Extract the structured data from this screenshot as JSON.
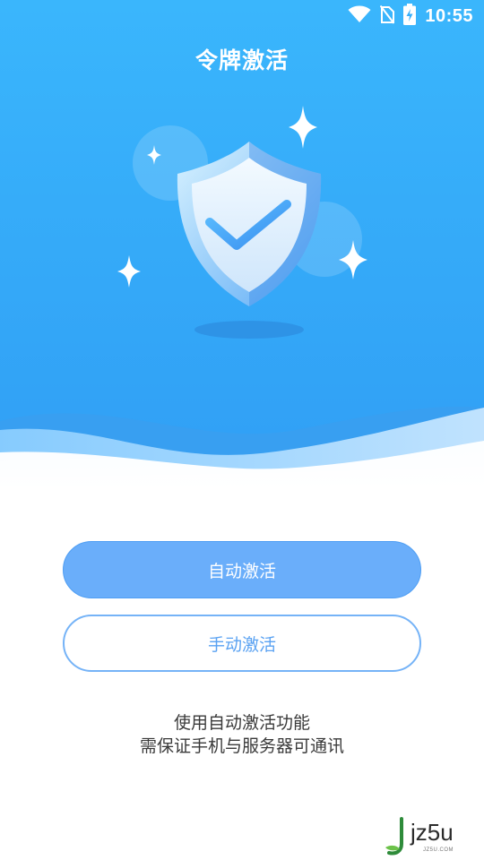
{
  "status_bar": {
    "time": "10:55",
    "icons": [
      "wifi-icon",
      "no-sim-icon",
      "battery-charging-icon"
    ]
  },
  "header": {
    "title": "令牌激活"
  },
  "illustration": {
    "icon": "shield-check-icon"
  },
  "actions": {
    "auto_label": "自动激活",
    "manual_label": "手动激活"
  },
  "hint": {
    "line1": "使用自动激活功能",
    "line2": "需保证手机与服务器可通讯"
  },
  "watermark": {
    "text": "jz5u",
    "sub": "JZ5U.COM"
  },
  "colors": {
    "hero_top": "#3db4fb",
    "hero_bottom": "#2f9ff5",
    "primary_button": "#6aaefa",
    "outline_button": "#75b3f7",
    "hint_text": "#3a3a3a"
  }
}
